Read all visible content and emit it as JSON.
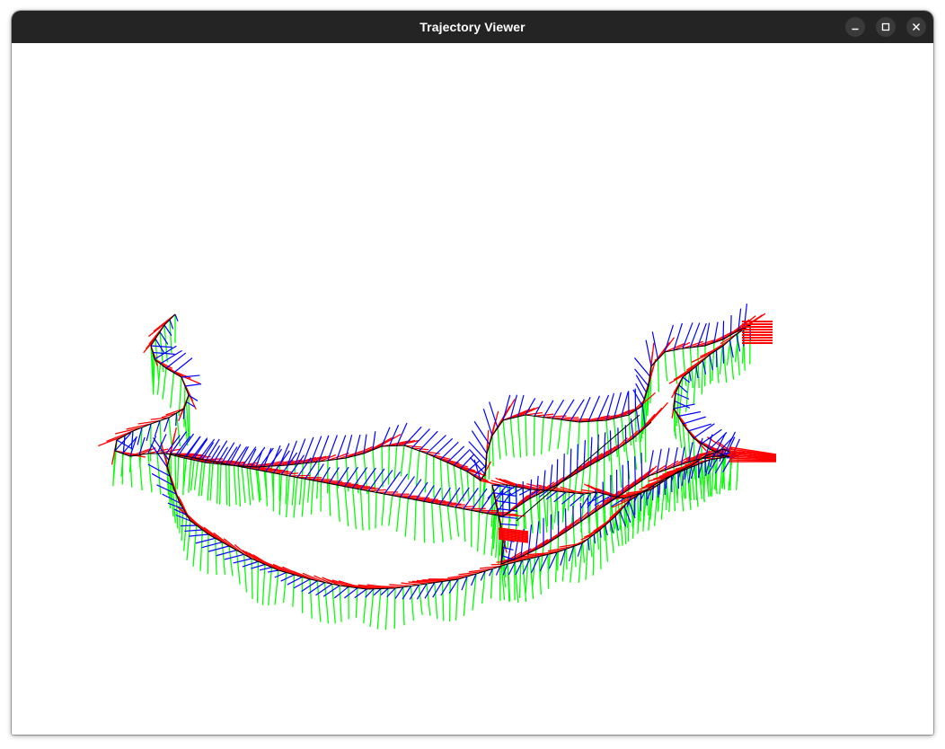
{
  "window": {
    "title": "Trajectory Viewer",
    "buttons": [
      {
        "name": "minimize-button",
        "icon": "minimize-icon"
      },
      {
        "name": "maximize-button",
        "icon": "maximize-icon"
      },
      {
        "name": "close-button",
        "icon": "close-icon"
      }
    ]
  },
  "viewer": {
    "axis_colors": {
      "x": "#ff0000",
      "y": "#00ff00",
      "z": "#0000ff"
    },
    "path_color": "#000000",
    "background": "#ffffff"
  }
}
